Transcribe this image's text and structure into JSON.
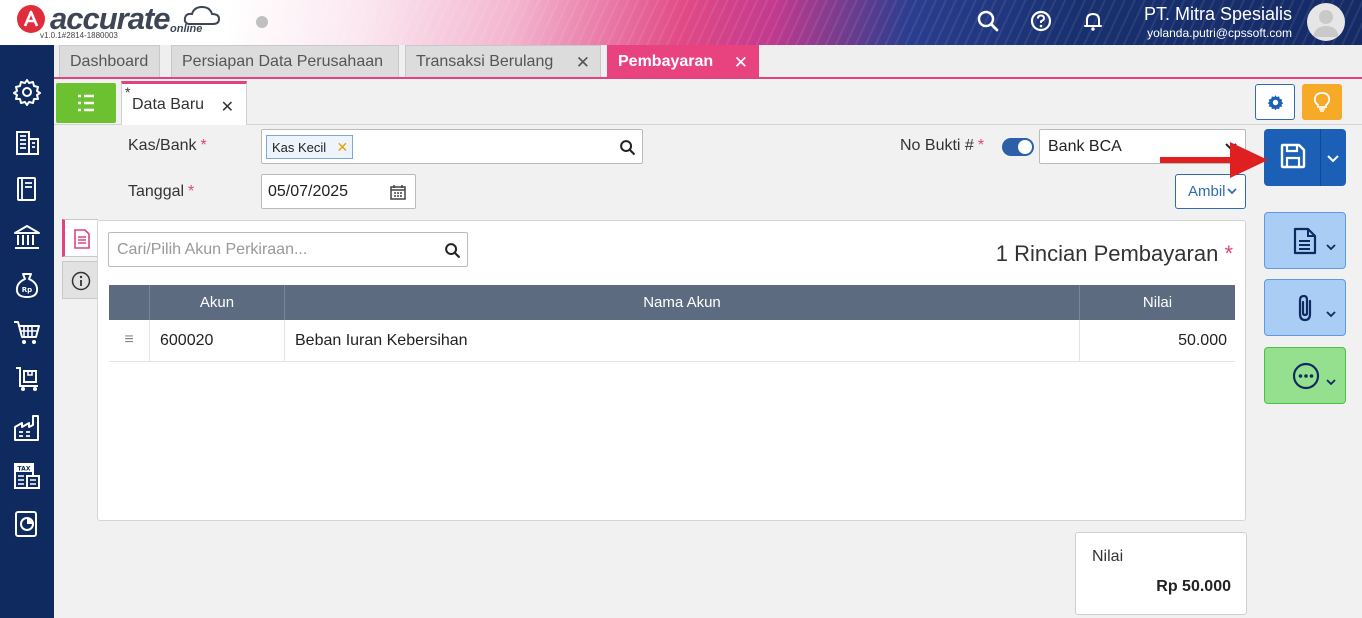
{
  "app": {
    "logo_text": "accurate",
    "logo_sub": "online",
    "version": "v1.0.1#2814-1880003",
    "company_name": "PT. Mitra Spesialis",
    "user_email": "yolanda.putri@cpssoft.com"
  },
  "header_icons": [
    "search-icon",
    "help-icon",
    "bell-icon",
    "avatar-icon"
  ],
  "sidebar": {
    "items": [
      {
        "icon": "gear-icon"
      },
      {
        "icon": "building-icon"
      },
      {
        "icon": "book-icon"
      },
      {
        "icon": "bank-icon"
      },
      {
        "icon": "money-bag-icon",
        "badge": "Rp"
      },
      {
        "icon": "cart-icon"
      },
      {
        "icon": "inventory-icon"
      },
      {
        "icon": "factory-icon"
      },
      {
        "icon": "tax-icon",
        "badge": "TAX"
      },
      {
        "icon": "report-icon"
      }
    ]
  },
  "tabs": [
    {
      "label": "Dashboard"
    },
    {
      "label": "Persiapan Data Perusahaan"
    },
    {
      "label": "Transaksi Berulang"
    },
    {
      "label": "Pembayaran",
      "active": true
    }
  ],
  "tab_count": "4",
  "subtab": {
    "star": "*",
    "label": "Data Baru"
  },
  "form": {
    "kas_bank_label": "Kas/Bank",
    "kas_bank_value": "Kas Kecil",
    "tanggal_label": "Tanggal",
    "tanggal_value": "05/07/2025",
    "no_bukti_label": "No Bukti #",
    "no_bukti_value": "Bank BCA",
    "required_mark": "*",
    "ambil_label": "Ambil"
  },
  "detail": {
    "search_placeholder": "Cari/Pilih Akun Perkiraan...",
    "title": "1 Rincian Pembayaran",
    "columns": [
      "Akun",
      "Nama Akun",
      "Nilai"
    ],
    "rows": [
      {
        "akun": "600020",
        "nama_akun": "Beban Iuran Kebersihan",
        "nilai": "50.000"
      }
    ]
  },
  "total": {
    "label": "Nilai",
    "value": "Rp 50.000"
  },
  "colors": {
    "accent": "#e9437f",
    "sidebar": "#0f2a5f",
    "save_button": "#1b5fb6",
    "green": "#6bc12f",
    "light_blue": "#a9cdf5",
    "light_green": "#95e08f",
    "annotation_arrow": "#e02020"
  }
}
